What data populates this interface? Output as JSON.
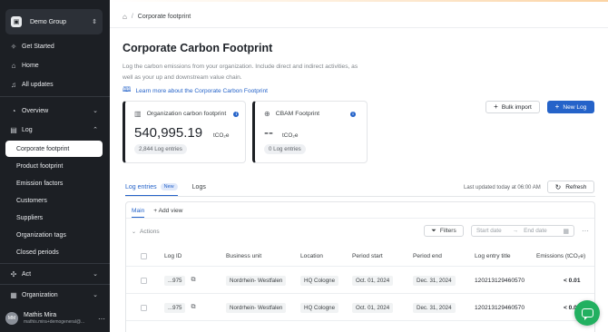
{
  "sidebar": {
    "org": {
      "name": "Demo Group",
      "logo_icon": "building-icon"
    },
    "items": [
      {
        "label": "Get Started",
        "icon": "rocket-icon"
      },
      {
        "label": "Home",
        "icon": "home-icon"
      },
      {
        "label": "All updates",
        "icon": "bell-icon"
      },
      {
        "label": "Overview",
        "icon": "pie-icon"
      },
      {
        "label": "Log",
        "icon": "file-icon"
      }
    ],
    "log_sub": [
      "Corporate footprint",
      "Product footprint",
      "Emission factors",
      "Customers",
      "Suppliers",
      "Organization tags",
      "Closed periods"
    ],
    "act": {
      "label": "Act",
      "icon": "target-icon"
    },
    "organization": {
      "label": "Organization",
      "icon": "org-icon"
    },
    "user": {
      "initials": "MM",
      "name": "Mathis Mira",
      "email": "mathis.mira+demogeneral@..."
    }
  },
  "breadcrumb": {
    "current": "Corporate footprint"
  },
  "page": {
    "title": "Corporate Carbon Footprint",
    "description": "Log the carbon emissions from your organization. Include direct and indirect activities, as well as your up and downstream value chain.",
    "learn_link": "Learn more about the Corporate Carbon Footprint",
    "bulk_import": "Bulk import",
    "new_log": "New Log"
  },
  "cards": [
    {
      "title": "Organization carbon footprint",
      "value": "540,995.19",
      "unit": "tCO₂e",
      "badge": "2,844 Log entries"
    },
    {
      "title": "CBAM Footprint",
      "value": "--",
      "unit": "tCO₂e",
      "badge": "0 Log entries"
    }
  ],
  "tabs": {
    "log_entries": "Log entries",
    "new_badge": "New",
    "logs": "Logs"
  },
  "updated_text": "Last updated today at 06:00 AM",
  "refresh_label": "Refresh",
  "subtabs": {
    "main": "Main",
    "add_view": "+ Add view"
  },
  "toolbar": {
    "actions": "Actions",
    "filters": "Filters",
    "start_placeholder": "Start date",
    "end_placeholder": "End date"
  },
  "table": {
    "headers": [
      "Log ID",
      "Business unit",
      "Location",
      "Period start",
      "Period end",
      "Log entry title",
      "Emissions (tCO₂e)"
    ],
    "rows": [
      {
        "id": "...975",
        "unit": "Nordrhein- Westfalen",
        "location": "HQ Cologne",
        "start": "Oct. 01, 2024",
        "end": "Dec. 31, 2024",
        "title": "120213129460570",
        "emissions": "< 0.01"
      },
      {
        "id": "...975",
        "unit": "Nordrhein- Westfalen",
        "location": "HQ Cologne",
        "start": "Oct. 01, 2024",
        "end": "Dec. 31, 2024",
        "title": "120213129460570",
        "emissions": "< 0.01"
      }
    ]
  },
  "colors": {
    "primary": "#2563c9",
    "sidebar": "#1c1f24",
    "chat": "#22b060"
  }
}
